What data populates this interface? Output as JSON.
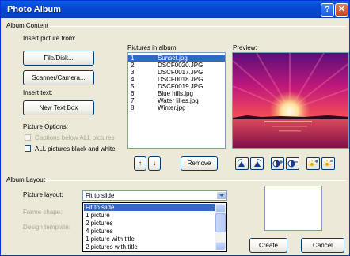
{
  "window": {
    "title": "Photo Album",
    "help_glyph": "?",
    "close_glyph": "✕"
  },
  "content": {
    "group_label": "Album Content",
    "insert_from_label": "Insert picture from:",
    "file_disk_button": "File/Disk...",
    "scanner_button": "Scanner/Camera...",
    "insert_text_label": "Insert text:",
    "new_text_box_button": "New Text Box",
    "picture_options_label": "Picture Options:",
    "captions_checkbox": "Captions below ALL pictures",
    "bw_checkbox": "ALL pictures black and white",
    "pictures_label": "Pictures in album:",
    "preview_label": "Preview:",
    "pictures": [
      {
        "num": "1",
        "name": "Sunset.jpg",
        "selected": true
      },
      {
        "num": "2",
        "name": "DSCF0020.JPG"
      },
      {
        "num": "3",
        "name": "DSCF0017.JPG"
      },
      {
        "num": "4",
        "name": "DSCF0018.JPG"
      },
      {
        "num": "5",
        "name": "DSCF0019.JPG"
      },
      {
        "num": "6",
        "name": "Blue hills.jpg"
      },
      {
        "num": "7",
        "name": "Water lilies.jpg"
      },
      {
        "num": "8",
        "name": "Winter.jpg"
      }
    ],
    "move_up_glyph": "↑",
    "move_down_glyph": "↓",
    "remove_button": "Remove",
    "tool_icons": [
      "rotate-left-icon",
      "rotate-right-icon",
      "contrast-up-icon",
      "contrast-down-icon",
      "brightness-up-icon",
      "brightness-down-icon"
    ]
  },
  "layout": {
    "group_label": "Album Layout",
    "picture_layout_label": "Picture layout:",
    "picture_layout_value": "Fit to slide",
    "frame_shape_label": "Frame shape:",
    "design_template_label": "Design template:",
    "options": [
      {
        "label": "Fit to slide",
        "selected": true
      },
      {
        "label": "1 picture"
      },
      {
        "label": "2 pictures"
      },
      {
        "label": "4 pictures"
      },
      {
        "label": "1 picture with title"
      },
      {
        "label": "2 pictures with title"
      }
    ]
  },
  "footer": {
    "create_button": "Create",
    "cancel_button": "Cancel"
  },
  "colors": {
    "title_blue": "#0847d3",
    "selection": "#316ac5",
    "window_bg": "#ece9d8"
  }
}
